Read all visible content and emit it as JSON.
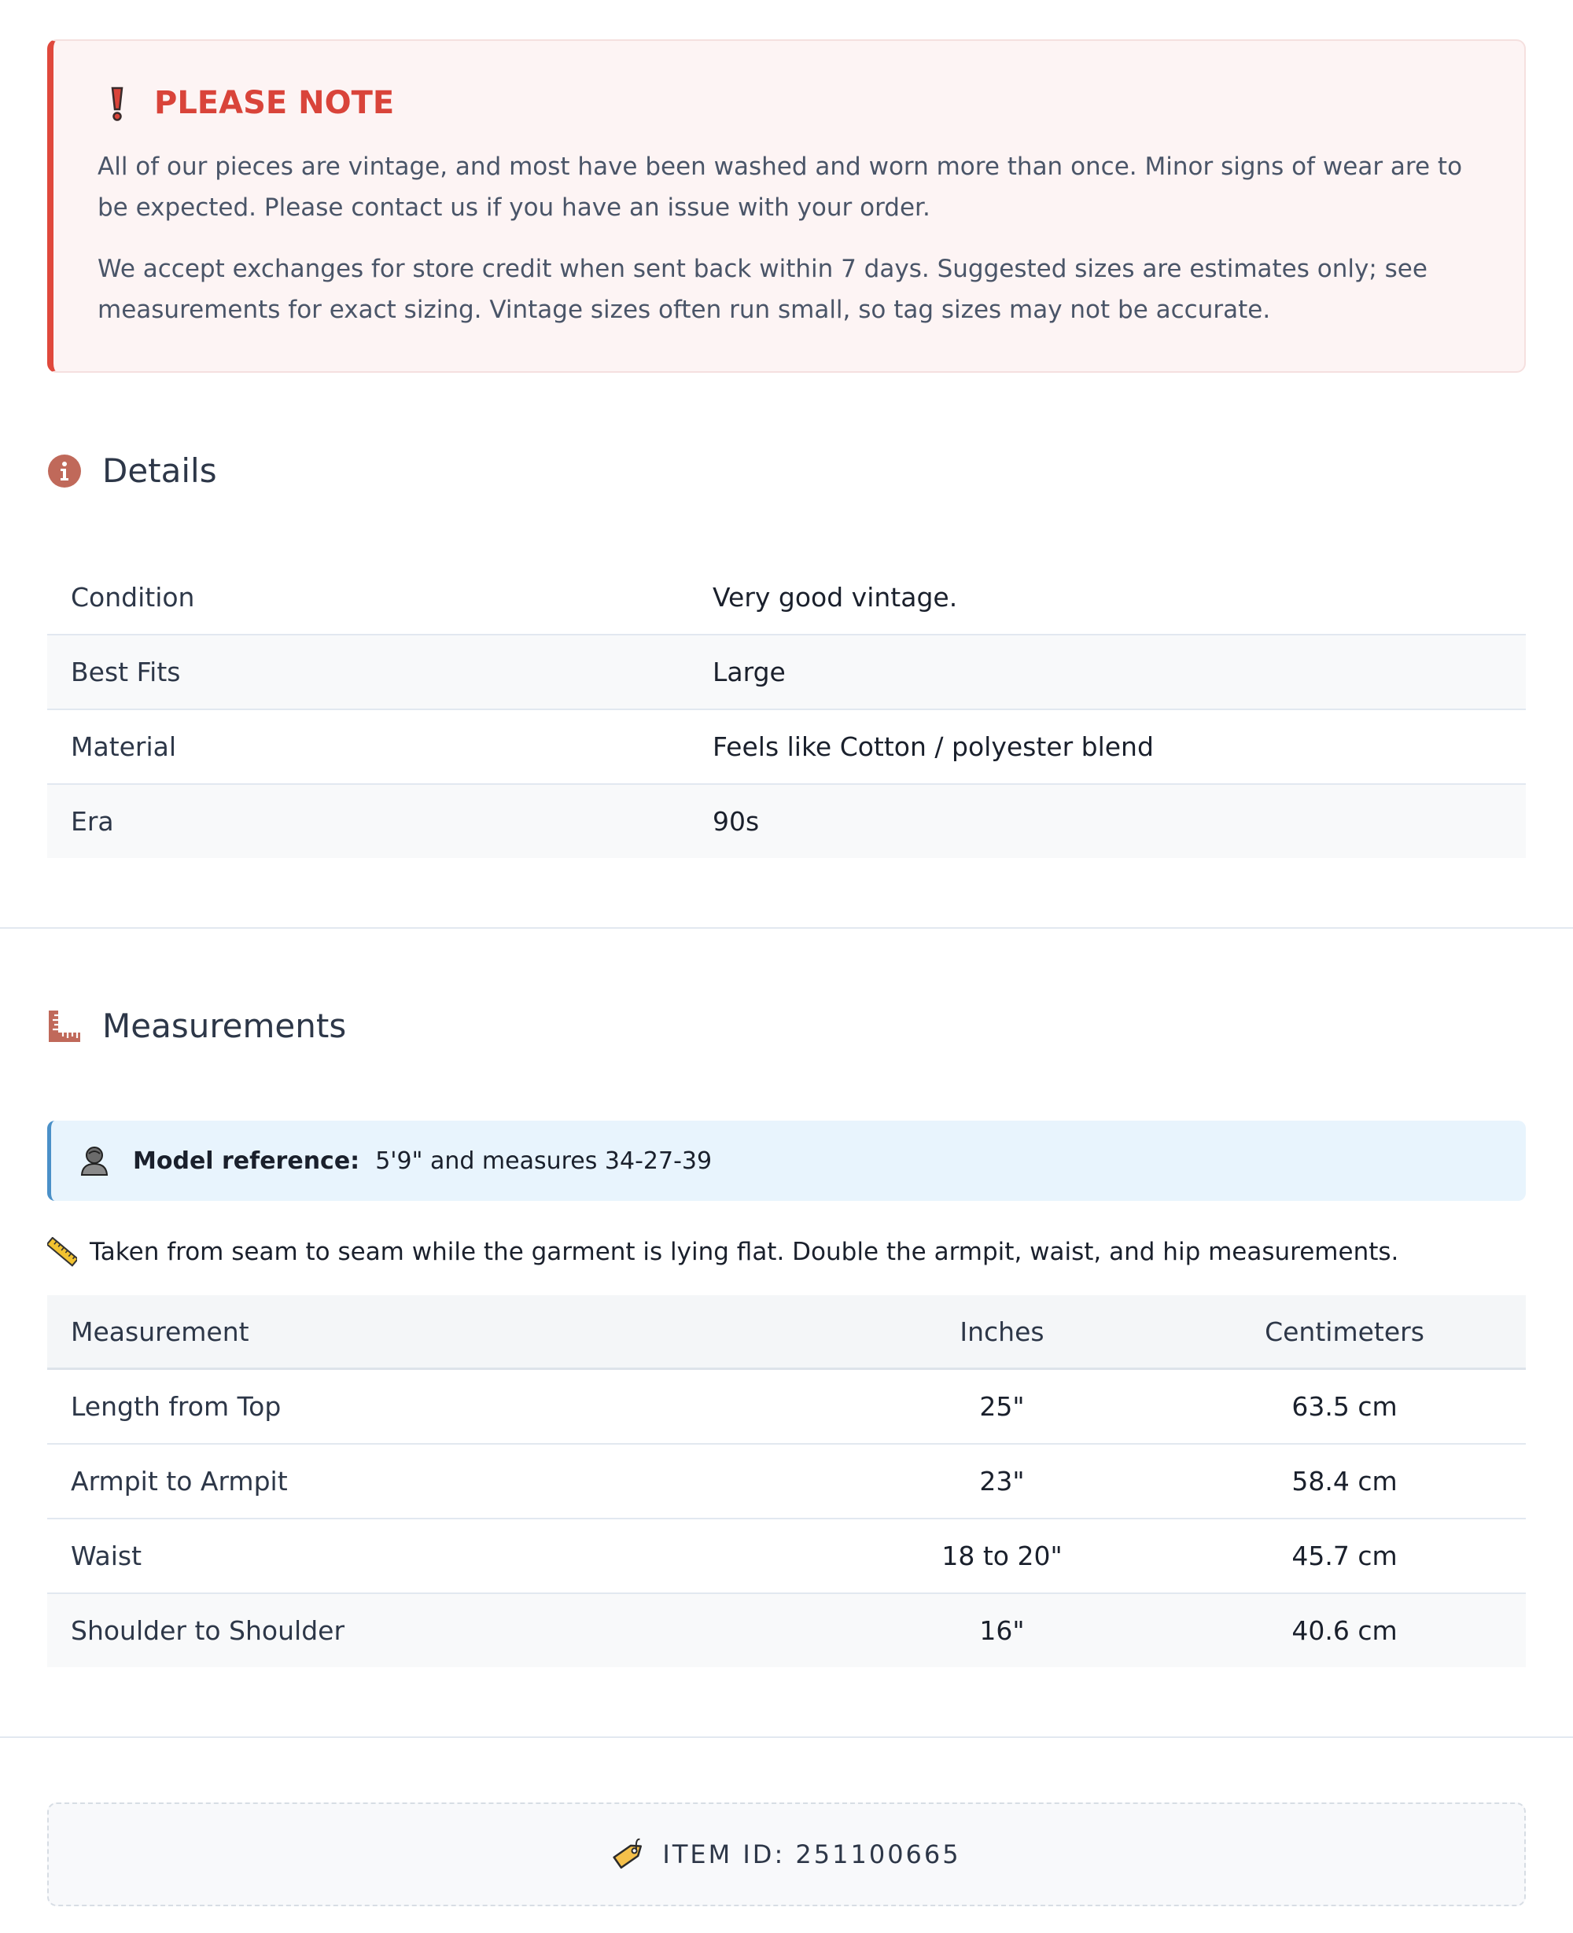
{
  "notice": {
    "title": "PLEASE NOTE",
    "paragraph1": "All of our pieces are vintage, and most have been washed and worn more than once. Minor signs of wear are to be expected. Please contact us if you have an issue with your order.",
    "paragraph2": "We accept exchanges for store credit when sent back within 7 days. Suggested sizes are estimates only; see measurements for exact sizing. Vintage sizes often run small, so tag sizes may not be accurate.",
    "icon": "exclamation-icon",
    "accent_color": "#e0483c"
  },
  "details": {
    "title": "Details",
    "icon": "info-icon",
    "rows": [
      {
        "label": "Condition",
        "value": "Very good vintage."
      },
      {
        "label": "Best Fits",
        "value": "Large"
      },
      {
        "label": "Material",
        "value": "Feels like Cotton / polyester blend"
      },
      {
        "label": "Era",
        "value": "90s"
      }
    ]
  },
  "measurements": {
    "title": "Measurements",
    "icon": "ruler-icon",
    "model_reference": {
      "label": "Model reference:",
      "value": "5'9\" and measures 34-27-39",
      "icon": "person-icon"
    },
    "note": "Taken from seam to seam while the garment is lying flat. Double the armpit, waist, and hip measurements.",
    "table": {
      "headers": [
        "Measurement",
        "Inches",
        "Centimeters"
      ],
      "rows": [
        {
          "name": "Length from Top",
          "inches": "25\"",
          "cm": "63.5 cm"
        },
        {
          "name": "Armpit to Armpit",
          "inches": "23\"",
          "cm": "58.4 cm"
        },
        {
          "name": "Waist",
          "inches": "18 to 20\"",
          "cm": "45.7 cm"
        },
        {
          "name": "Shoulder to Shoulder",
          "inches": "16\"",
          "cm": "40.6 cm"
        }
      ]
    }
  },
  "item": {
    "label": "ITEM ID: 251100665",
    "icon": "tag-icon"
  }
}
